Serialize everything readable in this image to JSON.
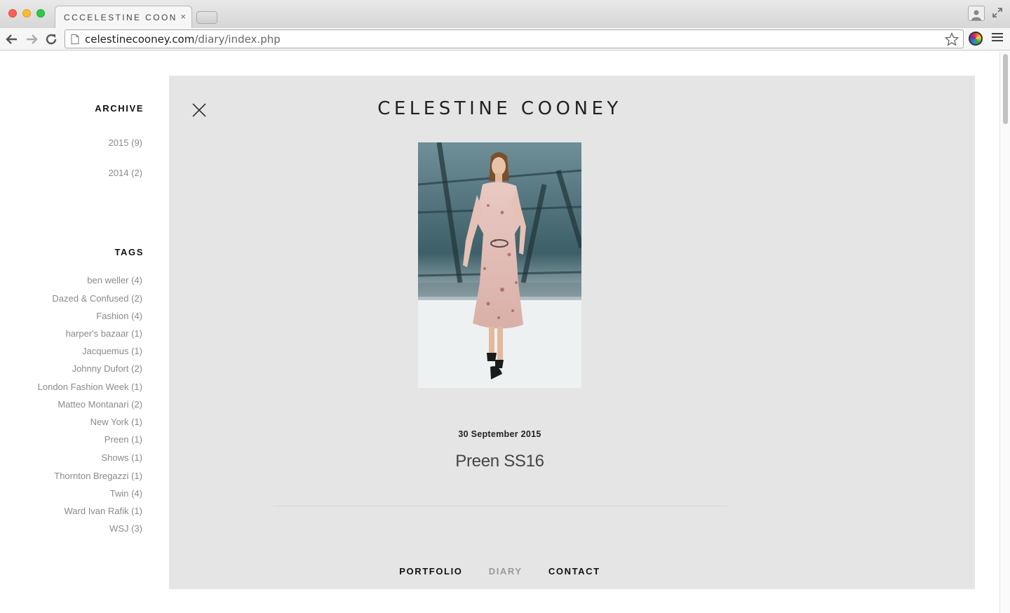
{
  "browser": {
    "tab_title": "CCCELESTINE COONEY",
    "tab_close": "×",
    "url_host": "celestinecooney.com",
    "url_path": "/diary/index.php"
  },
  "sidebar": {
    "archive_heading": "ARCHIVE",
    "archive": [
      {
        "label": "2015 (9)"
      },
      {
        "label": "2014 (2)"
      }
    ],
    "tags_heading": "TAGS",
    "tags": [
      {
        "label": "ben weller (4)"
      },
      {
        "label": "Dazed & Confused (2)"
      },
      {
        "label": "Fashion (4)"
      },
      {
        "label": "harper's bazaar (1)"
      },
      {
        "label": "Jacquemus (1)"
      },
      {
        "label": "Johnny Dufort (2)"
      },
      {
        "label": "London Fashion Week (1)"
      },
      {
        "label": "Matteo Montanari (2)"
      },
      {
        "label": "New York (1)"
      },
      {
        "label": "Preen (1)"
      },
      {
        "label": "Shows (1)"
      },
      {
        "label": "Thornton Bregazzi (1)"
      },
      {
        "label": "Twin (4)"
      },
      {
        "label": "Ward Ivan Rafik (1)"
      },
      {
        "label": "WSJ (3)"
      }
    ]
  },
  "main": {
    "brand": "CELESTINE COONEY",
    "post_date": "30 September 2015",
    "post_title": "Preen SS16"
  },
  "footer_nav": {
    "portfolio": "PORTFOLIO",
    "diary": "DIARY",
    "contact": "CONTACT"
  },
  "colors": {
    "panel_bg": "#e5e5e5",
    "link_gray": "#8a8a8a",
    "active_nav": "#9a9a9a"
  }
}
